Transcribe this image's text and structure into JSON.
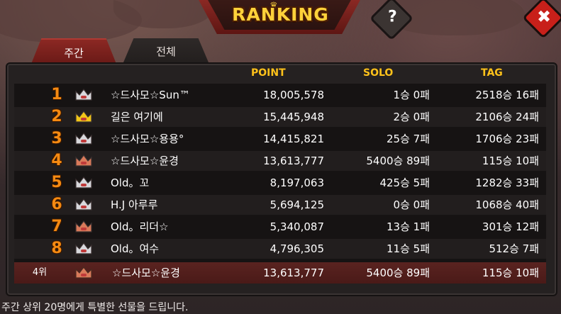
{
  "header": {
    "title": "RANKING",
    "help_label": "?",
    "close_label": "✖"
  },
  "tabs": [
    {
      "label": "주간",
      "active": true
    },
    {
      "label": "전체",
      "active": false
    }
  ],
  "columns": {
    "point": "POINT",
    "solo": "SOLO",
    "tag": "TAG"
  },
  "rows": [
    {
      "rank": "1",
      "crown": "silver",
      "name": "☆드사모☆Sun™",
      "point": "18,005,578",
      "solo": "1승 0패",
      "tag": "2518승 16패"
    },
    {
      "rank": "2",
      "crown": "gold",
      "name": "길은 여기에",
      "point": "15,445,948",
      "solo": "2승 0패",
      "tag": "2106승 24패"
    },
    {
      "rank": "3",
      "crown": "silver",
      "name": "☆드사모☆용용°",
      "point": "14,415,821",
      "solo": "25승 7패",
      "tag": "1706승 23패"
    },
    {
      "rank": "4",
      "crown": "bronze",
      "name": "☆드사모☆윤경",
      "point": "13,613,777",
      "solo": "5400승 89패",
      "tag": "115승 10패"
    },
    {
      "rank": "5",
      "crown": "silver",
      "name": "Old。꼬",
      "point": "8,197,063",
      "solo": "425승 5패",
      "tag": "1282승 33패"
    },
    {
      "rank": "6",
      "crown": "silver",
      "name": "H.J 아루루",
      "point": "5,694,125",
      "solo": "0승 0패",
      "tag": "1068승 40패"
    },
    {
      "rank": "7",
      "crown": "bronze",
      "name": "Old。리더☆",
      "point": "5,340,087",
      "solo": "13승 1패",
      "tag": "301승 12패"
    },
    {
      "rank": "8",
      "crown": "silver",
      "name": "Old。여수",
      "point": "4,796,305",
      "solo": "11승 5패",
      "tag": "512승 7패"
    }
  ],
  "my_rank": {
    "rank": "4위",
    "crown": "bronze",
    "name": "☆드사모☆윤경",
    "point": "13,613,777",
    "solo": "5400승 89패",
    "tag": "115승 10패"
  },
  "footer": "주간 상위 20명에게 특별한 선물을 드립니다.",
  "colors": {
    "gold": "#f2c618",
    "silver": "#d8d8dc",
    "bronze": "#d97a5a",
    "accent": "#ffc21a",
    "rank": "#f58a12"
  }
}
